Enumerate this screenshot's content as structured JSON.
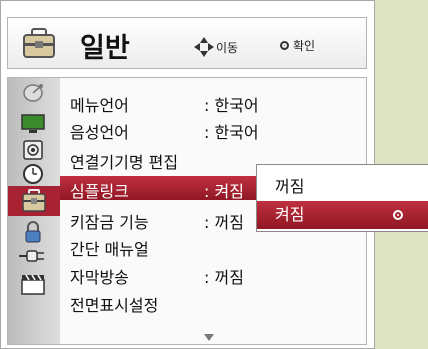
{
  "header": {
    "title": "일반",
    "icon": "toolbox-icon",
    "hints": {
      "move": "이동",
      "ok": "확인"
    }
  },
  "sidebar": {
    "icons": [
      "satellite-icon",
      "monitor-icon",
      "speaker-icon",
      "clock-icon",
      "toolbox-icon",
      "lock-icon",
      "plug-icon",
      "clapperboard-icon"
    ],
    "active_index": 4
  },
  "menu": {
    "items": [
      {
        "label": "메뉴언어",
        "value": ": 한국어"
      },
      {
        "label": "음성언어",
        "value": ": 한국어"
      },
      {
        "label": "연결기기명 편집",
        "value": ""
      },
      {
        "label": "심플링크",
        "value": ": 켜짐"
      },
      {
        "label": "키잠금 기능",
        "value": ": 꺼짐"
      },
      {
        "label": "간단 매뉴얼",
        "value": ""
      },
      {
        "label": "자막방송",
        "value": ": 꺼짐"
      },
      {
        "label": "전면표시설정",
        "value": ""
      }
    ],
    "highlighted_index": 3
  },
  "popup": {
    "options": [
      "꺼짐",
      "켜짐"
    ],
    "selected_index": 1
  },
  "colors": {
    "accent": "#a72333",
    "background": "#dde2c0"
  }
}
